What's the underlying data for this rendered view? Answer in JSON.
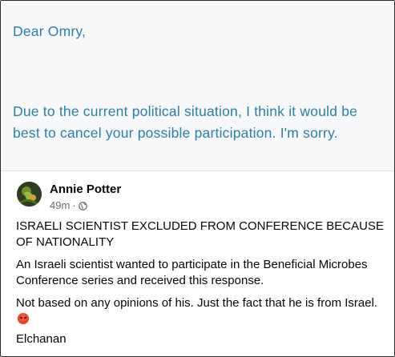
{
  "email": {
    "greeting": "Dear Omry,",
    "body_line1": "Due to the current political situation, I think it would be",
    "body_line2": "best to cancel your possible participation. I'm sorry."
  },
  "post": {
    "author": "Annie Potter",
    "time": "49m",
    "separator": "·",
    "audience_icon": "globe-icon",
    "headline": "ISRAELI SCIENTIST EXCLUDED FROM CONFERENCE BECAUSE OF NATIONALITY",
    "paragraph1": "An Israeli scientist wanted to participate in the Beneficial Microbes Conference series and received this response.",
    "paragraph2": "Not based on any opinions of his. Just the fact that he is from Israel.",
    "paragraph2_emoji": "angry-face-emoji",
    "signature": "Elchanan"
  },
  "colors": {
    "email_text": "#2a7fa6",
    "meta_text": "#65676b",
    "body_text": "#050505"
  }
}
